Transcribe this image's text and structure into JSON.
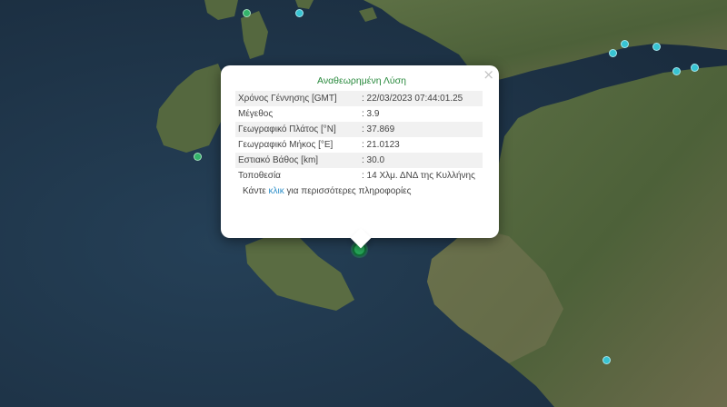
{
  "popup": {
    "title": "Αναθεωρημένη Λύση",
    "close_symbol": "×",
    "rows": [
      {
        "key": "Χρόνος Γέννησης [GMT]",
        "value": ": 22/03/2023 07:44:01.25"
      },
      {
        "key": "Μέγεθος",
        "value": ": 3.9"
      },
      {
        "key": "Γεωγραφικό Πλάτος [°N]",
        "value": ": 37.869"
      },
      {
        "key": "Γεωγραφικό Μήκος [°E]",
        "value": ": 21.0123"
      },
      {
        "key": "Εστιακό Βάθος [km]",
        "value": ": 30.0"
      },
      {
        "key": "Τοποθεσία",
        "value": ": 14 Χλμ. ΔΝΔ της Κυλλήνης"
      }
    ],
    "footer_pre": "Κάντε ",
    "footer_link": "κλικ",
    "footer_post": " για περισσότερες πληροφορίες"
  },
  "markers": [
    {
      "color": "green"
    },
    {
      "color": "cyan"
    },
    {
      "color": "cyan"
    },
    {
      "color": "cyan"
    },
    {
      "color": "cyan"
    },
    {
      "color": "cyan"
    },
    {
      "color": "cyan"
    },
    {
      "color": "green"
    },
    {
      "color": "cyan"
    },
    {
      "color": "green",
      "selected": true
    }
  ],
  "colors": {
    "sea": "#1f3347",
    "land": "#55683f",
    "marker_cyan": "#37c4d3",
    "marker_green": "#33b36a"
  }
}
